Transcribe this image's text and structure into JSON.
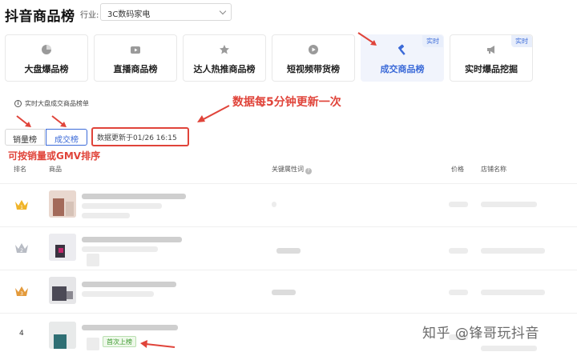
{
  "header": {
    "title": "抖音商品榜",
    "industry_label": "行业:",
    "industry_value": "3C数码家电"
  },
  "cards": [
    {
      "label": "大盘爆品榜",
      "icon": "pie-chart-icon",
      "active": false,
      "badge": ""
    },
    {
      "label": "直播商品榜",
      "icon": "live-video-icon",
      "active": false,
      "badge": ""
    },
    {
      "label": "达人热推商品榜",
      "icon": "star-icon",
      "active": false,
      "badge": ""
    },
    {
      "label": "短视频带货榜",
      "icon": "play-icon",
      "active": false,
      "badge": ""
    },
    {
      "label": "成交商品榜",
      "icon": "hammer-icon",
      "active": true,
      "badge": "实时"
    },
    {
      "label": "实时爆品挖掘",
      "icon": "megaphone-icon",
      "active": false,
      "badge": "实时"
    }
  ],
  "info": {
    "text": "实时大盘成交商品榜单"
  },
  "annotations": {
    "update_note": "数据每5分钟更新一次",
    "sort_note": "可按销量或GMV排序"
  },
  "toggles": {
    "sales": "销量榜",
    "deal": "成交榜"
  },
  "update_time": "数据更新于01/26 16:15",
  "table": {
    "headers": {
      "rank": "排名",
      "product": "商品",
      "keywords": "关键属性词",
      "price": "价格",
      "store": "店铺名称"
    },
    "rows": [
      {
        "rank": "1",
        "rank_type": "gold-crown"
      },
      {
        "rank": "2",
        "rank_type": "silver-crown"
      },
      {
        "rank": "3",
        "rank_type": "bronze-crown"
      },
      {
        "rank": "4",
        "rank_type": "number",
        "new_tag": "首次上榜"
      }
    ]
  },
  "watermark": "知乎 @锋哥玩抖音",
  "colors": {
    "accent": "#3b6ad8",
    "annotation": "#e0443a",
    "active_card_bg": "#f1f4fc"
  }
}
